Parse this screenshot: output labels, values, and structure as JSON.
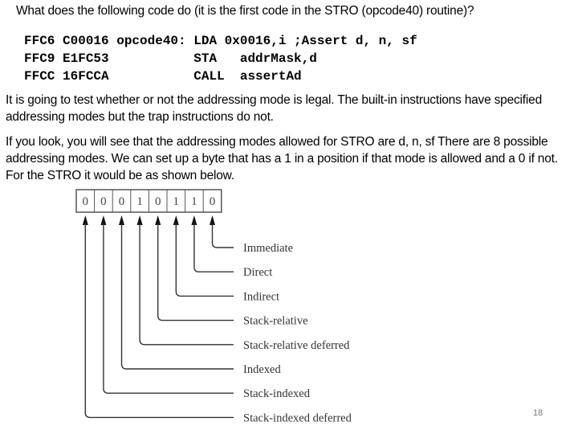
{
  "question": "What does the following code do (it is the first code in the STRO (opcode40) routine)?",
  "code_lines": [
    "FFC6 C00016 opcode40: LDA 0x0016,i ;Assert d, n, sf",
    "FFC9 E1FC53           STA   addrMask,d",
    "FFCC 16FCCA           CALL  assertAd"
  ],
  "paragraphs": [
    "It is going to test whether or not the addressing mode is legal.  The built-in instructions have specified addressing modes but the trap instructions do not.",
    "If you look, you will see that the addressing modes allowed for STRO are  d, n, sf  There are 8 possible addressing modes.  We can set up a byte that has a 1 in a position if that mode is allowed and a 0 if not.  For the STRO it would be as shown below."
  ],
  "diagram": {
    "bits": [
      "0",
      "0",
      "0",
      "1",
      "0",
      "1",
      "1",
      "0"
    ],
    "labels": [
      "Immediate",
      "Direct",
      "Indirect",
      "Stack-relative",
      "Stack-relative deferred",
      "Indexed",
      "Stack-indexed",
      "Stack-indexed deferred"
    ]
  },
  "page_number": "18"
}
